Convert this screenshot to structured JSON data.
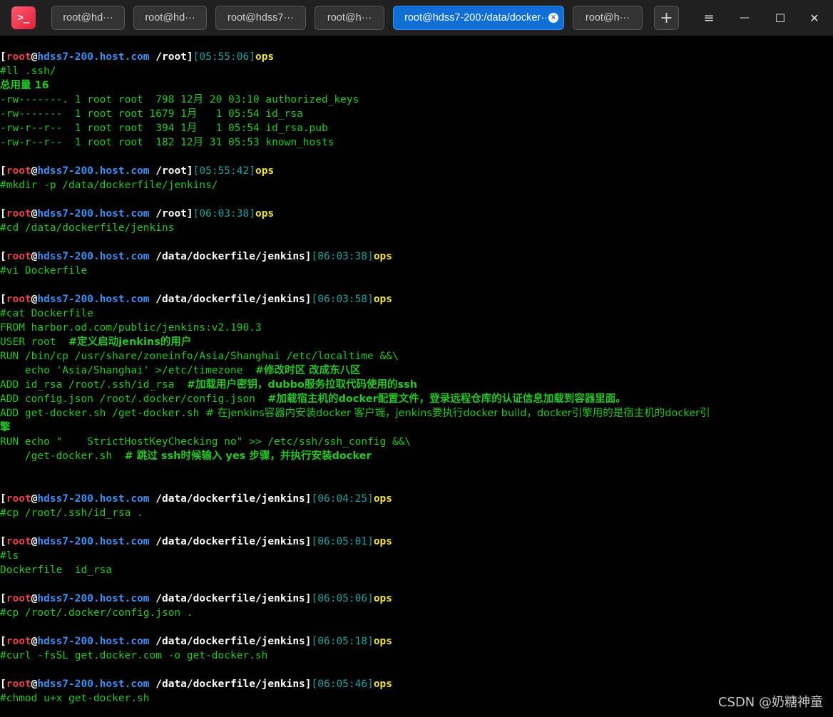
{
  "window": {
    "app_icon_glyph": ">_",
    "tabs": [
      {
        "label": "root@hd···"
      },
      {
        "label": "root@hd···"
      },
      {
        "label": "root@hdss7···"
      },
      {
        "label": "root@h···"
      },
      {
        "label": "root@hdss7-200:/data/docker···",
        "active": true
      },
      {
        "label": "root@h···"
      }
    ],
    "new_tab_glyph": "+",
    "controls": {
      "menu": "≡",
      "minimize": "—",
      "maximize": "☐",
      "close": "✕"
    },
    "close_tab_glyph": "×"
  },
  "prompt": {
    "user": "root",
    "host": "hdss7-200.host.com",
    "cmd_label": "ops"
  },
  "terminal": {
    "p1": {
      "cwd": "/root",
      "time": "05:55:06"
    },
    "c1": "#ll .ssh/",
    "o_total": "总用量 16",
    "ls_rows": [
      "-rw-------. 1 root root  798 12月 20 03:10 authorized_keys",
      "-rw-------  1 root root 1679 1月   1 05:54 id_rsa",
      "-rw-r--r--  1 root root  394 1月   1 05:54 id_rsa.pub",
      "-rw-r--r--  1 root root  182 12月 31 05:53 known_hosts"
    ],
    "p2": {
      "cwd": "/root",
      "time": "05:55:42"
    },
    "c2": "#mkdir -p /data/dockerfile/jenkins/",
    "p3": {
      "cwd": "/root",
      "time": "06:03:38"
    },
    "c3": "#cd /data/dockerfile/jenkins",
    "p4": {
      "cwd": "/data/dockerfile/jenkins",
      "time": "06:03:38"
    },
    "c4": "#vi Dockerfile",
    "p5": {
      "cwd": "/data/dockerfile/jenkins",
      "time": "06:03:58"
    },
    "c5": "#cat Dockerfile",
    "df_from": "FROM harbor.od.com/public/jenkins:v2.190.3",
    "df_user_code": "USER root  ",
    "df_user_comment": "#定义启动jenkins的用户",
    "df_run1": "RUN /bin/cp /usr/share/zoneinfo/Asia/Shanghai /etc/localtime &&\\",
    "df_echo_code": "    echo 'Asia/Shanghai' >/etc/timezone  ",
    "df_echo_comment": "#修改时区 改成东八区",
    "df_add1_code": "ADD id_rsa /root/.ssh/id_rsa  ",
    "df_add1_comment": "#加载用户密钥，dubbo服务拉取代码使用的ssh",
    "df_add2_code": "ADD config.json /root/.docker/config.json  ",
    "df_add2_comment": "#加载宿主机的docker配置文件，登录远程仓库的认证信息加载到容器里面。",
    "df_add3_code": "ADD get-docker.sh /get-docker.sh ",
    "df_add3_comment": "# 在jenkins容器内安装docker 客户端，jenkins要执行docker build，docker引擎用的是宿主机的docker引",
    "df_add3_wrap": "擎",
    "df_run2": "RUN echo \"    StrictHostKeyChecking no\" >> /etc/ssh/ssh_config &&\\",
    "df_getdocker_code": "    /get-docker.sh  ",
    "df_getdocker_comment": "# 跳过 ssh时候输入 yes 步骤，并执行安装docker",
    "p6": {
      "cwd": "/data/dockerfile/jenkins",
      "time": "06:04:25"
    },
    "c6": "#cp /root/.ssh/id_rsa .",
    "p7": {
      "cwd": "/data/dockerfile/jenkins",
      "time": "06:05:01"
    },
    "c7": "#ls",
    "o7": "Dockerfile  id_rsa",
    "p8": {
      "cwd": "/data/dockerfile/jenkins",
      "time": "06:05:06"
    },
    "c8": "#cp /root/.docker/config.json .",
    "p9": {
      "cwd": "/data/dockerfile/jenkins",
      "time": "06:05:18"
    },
    "c9": "#curl -fsSL get.docker.com -o get-docker.sh",
    "p10": {
      "cwd": "/data/dockerfile/jenkins",
      "time": "06:05:46"
    },
    "c10": "#chmod u+x get-docker.sh"
  },
  "watermark": "CSDN @奶糖神童"
}
